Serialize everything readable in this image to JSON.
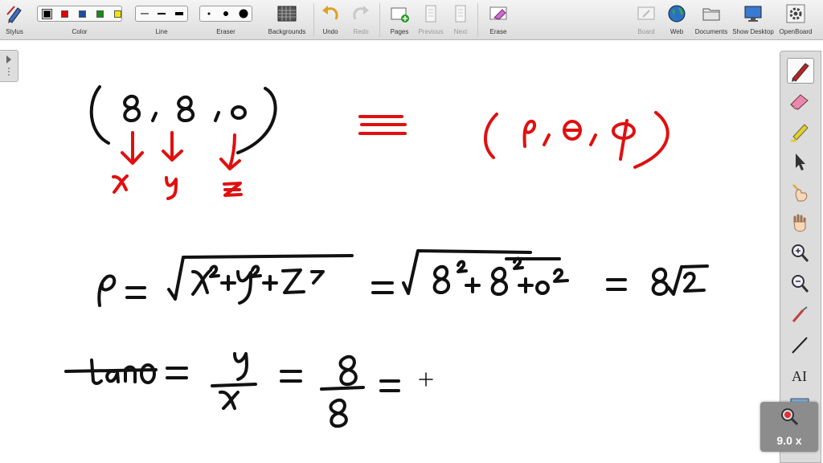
{
  "toolbar": {
    "stylus": "Stylus",
    "color": "Color",
    "line": "Line",
    "eraser": "Eraser",
    "backgrounds": "Backgrounds",
    "undo": "Undo",
    "redo": "Redo",
    "pages": "Pages",
    "previous": "Previous",
    "next": "Next",
    "erase": "Erase",
    "board": "Board",
    "web": "Web",
    "documents": "Documents",
    "show_desktop": "Show Desktop",
    "openboard": "OpenBoard"
  },
  "colors": {
    "swatches": [
      "#000000",
      "#e00000",
      "#1a4fa0",
      "#1a8a1a",
      "#f2e600"
    ],
    "ink_black": "#111111",
    "ink_red": "#e01010"
  },
  "dock_icons": [
    "pen-icon",
    "eraser-icon",
    "highlighter-icon",
    "pointer-icon",
    "laser-hand-icon",
    "hand-icon",
    "zoom-in-icon",
    "zoom-out-icon",
    "capture-icon",
    "line-icon",
    "text-icon",
    "grid-icon"
  ],
  "board": {
    "coords_left": "(8, 8, 0)",
    "coords_right": "(ρ, θ, φ)",
    "xyz": [
      "x",
      "y",
      "z"
    ],
    "equiv": "≡",
    "rho_line": "ρ = √(x²+y²+z²) = √(8²+8²+0²) = 8√2",
    "tan_line": "tanθ = y/x = 8/8 = +"
  },
  "zoom": {
    "value": "9.0 x"
  }
}
